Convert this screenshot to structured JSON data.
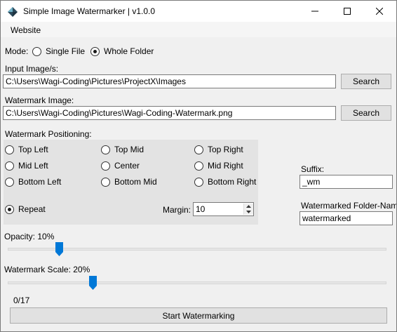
{
  "window": {
    "title": "Simple Image Watermarker | v1.0.0",
    "minimize_icon": "minimize-icon",
    "maximize_icon": "maximize-icon",
    "close_icon": "close-icon"
  },
  "menu": {
    "items": [
      "Website"
    ]
  },
  "mode": {
    "label": "Mode:",
    "options": [
      "Single File",
      "Whole Folder"
    ],
    "selected": "Whole Folder"
  },
  "input": {
    "label": "Input Image/s:",
    "value": "C:\\Users\\Wagi-Coding\\Pictures\\ProjectX\\Images",
    "button": "Search"
  },
  "watermark": {
    "label": "Watermark Image:",
    "value": "C:\\Users\\Wagi-Coding\\Pictures\\Wagi-Coding-Watermark.png",
    "button": "Search"
  },
  "positioning": {
    "label": "Watermark Positioning:",
    "options": [
      "Top Left",
      "Top Mid",
      "Top Right",
      "Mid Left",
      "Center",
      "Mid Right",
      "Bottom Left",
      "Bottom Mid",
      "Bottom Right",
      "Repeat"
    ],
    "selected": "Repeat",
    "margin_label": "Margin:",
    "margin_value": "10"
  },
  "suffix": {
    "label": "Suffix:",
    "value": "_wm"
  },
  "folder": {
    "label": "Watermarked Folder-Name:",
    "value": "watermarked"
  },
  "opacity": {
    "label": "Opacity: 10%",
    "level_percent": 10
  },
  "scale": {
    "label": "Watermark Scale: 20%",
    "level_percent": 20
  },
  "progress": {
    "text": "0/17"
  },
  "start_button": "Start Watermarking",
  "colors": {
    "slider_thumb": "#0078d7",
    "button_face": "#e1e1e1",
    "panel_bg": "#e3e3e3"
  }
}
